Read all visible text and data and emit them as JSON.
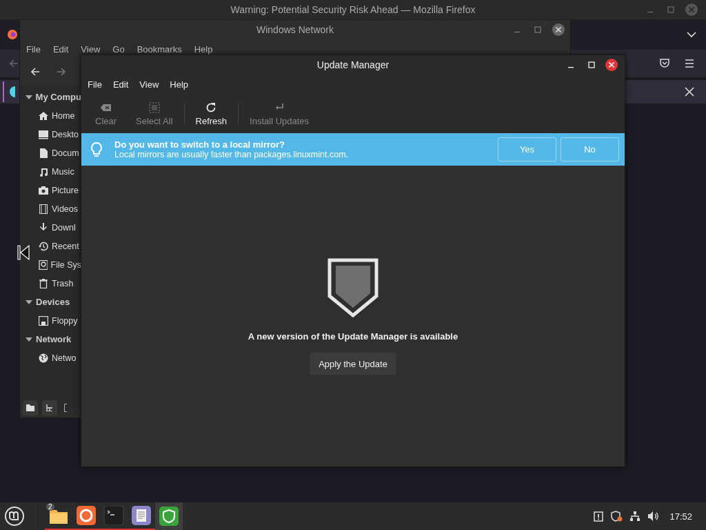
{
  "browser": {
    "title": "Warning: Potential Security Risk Ahead — Mozilla Firefox"
  },
  "file_manager": {
    "title": "Windows Network",
    "menu": [
      "File",
      "Edit",
      "View",
      "Go",
      "Bookmarks",
      "Help"
    ],
    "sidebar": [
      {
        "heading": "My Compu",
        "expanded": true,
        "items": [
          {
            "label": "Home",
            "kind": "home"
          },
          {
            "label": "Deskto",
            "kind": "desktop"
          },
          {
            "label": "Docum",
            "kind": "document"
          },
          {
            "label": "Music",
            "kind": "music"
          },
          {
            "label": "Picture",
            "kind": "camera"
          },
          {
            "label": "Videos",
            "kind": "film"
          },
          {
            "label": "Downl",
            "kind": "download"
          },
          {
            "label": "Recent",
            "kind": "history"
          },
          {
            "label": "File Sys",
            "kind": "disk"
          },
          {
            "label": "Trash",
            "kind": "trash"
          }
        ]
      },
      {
        "heading": "Devices",
        "expanded": true,
        "items": [
          {
            "label": "Floppy",
            "kind": "floppy"
          }
        ]
      },
      {
        "heading": "Network",
        "expanded": true,
        "items": [
          {
            "label": "Netwo",
            "kind": "globe"
          }
        ]
      }
    ]
  },
  "update_manager": {
    "title": "Update Manager",
    "menu": [
      "File",
      "Edit",
      "View",
      "Help"
    ],
    "toolbar": [
      {
        "label": "Clear",
        "kind": "clear",
        "disabled": true
      },
      {
        "label": "Select All",
        "kind": "select",
        "disabled": true
      },
      {
        "label": "Refresh",
        "kind": "refresh",
        "disabled": false
      },
      {
        "label": "Install Updates",
        "kind": "install",
        "disabled": true
      }
    ],
    "infobar": {
      "title": "Do you want to switch to a local mirror?",
      "text": "Local mirrors are usually faster than packages.linuxmint.com.",
      "buttons": [
        "Yes",
        "No"
      ]
    },
    "message": "A new version of the Update Manager is available",
    "button": "Apply the Update"
  },
  "taskbar": {
    "apps": [
      {
        "kind": "folder",
        "badge": "2",
        "active": false
      },
      {
        "kind": "firefox",
        "active": false
      },
      {
        "kind": "terminal",
        "active": false
      },
      {
        "kind": "editor",
        "active": false
      },
      {
        "kind": "shield",
        "active": true
      }
    ],
    "clock": "17:52"
  }
}
